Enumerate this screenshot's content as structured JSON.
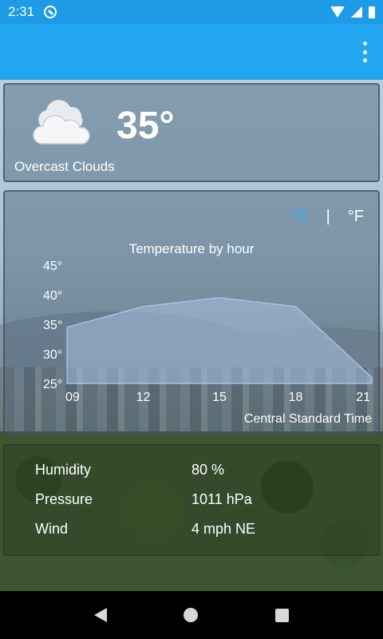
{
  "status_bar": {
    "time": "2:31"
  },
  "current": {
    "temperature": "35°",
    "condition": "Overcast Clouds"
  },
  "units": {
    "celsius": "°C",
    "separator": "|",
    "fahrenheit": "°F",
    "selected": "°C"
  },
  "chart_data": {
    "type": "area",
    "title": "Temperature by hour",
    "x": [
      9,
      12,
      15,
      18,
      21
    ],
    "x_tick_labels": [
      "09",
      "12",
      "15",
      "18",
      "21"
    ],
    "values": [
      34.5,
      38,
      39.5,
      38,
      26
    ],
    "ylim": [
      25,
      45
    ],
    "y_ticks": [
      45,
      40,
      35,
      30,
      25
    ],
    "y_tick_labels": [
      "45°",
      "40°",
      "35°",
      "30°",
      "25°"
    ],
    "fill_color": "#a9c0e0",
    "grid": false
  },
  "timezone": "Central Standard Time",
  "details": {
    "humidity_label": "Humidity",
    "humidity_value": "80 %",
    "pressure_label": "Pressure",
    "pressure_value": "1011 hPa",
    "wind_label": "Wind",
    "wind_value": "4 mph NE"
  },
  "colors": {
    "app_bar": "#23a6f2",
    "status_bar": "#1e9be6",
    "accent_unit": "#2aa9f5"
  }
}
